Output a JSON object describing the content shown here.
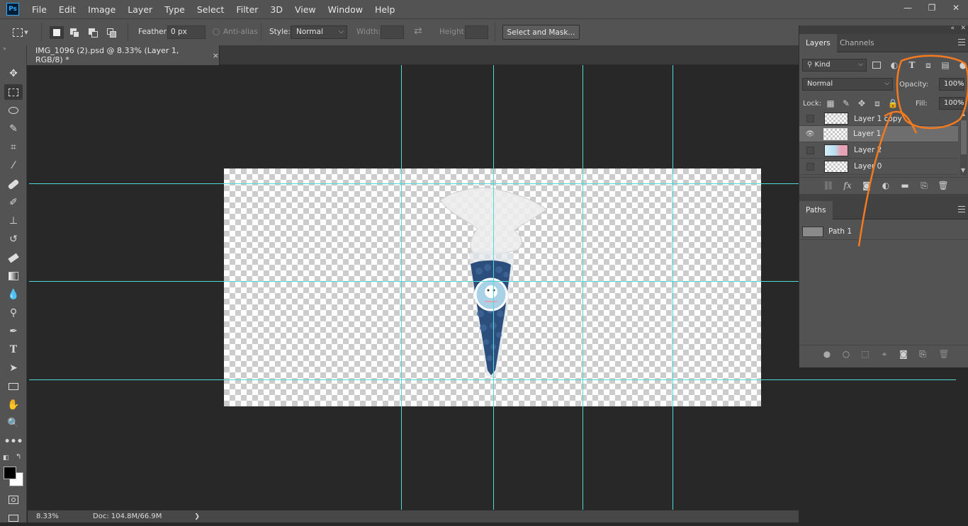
{
  "app": {
    "logo_text": "Ps",
    "menu": [
      "File",
      "Edit",
      "Image",
      "Layer",
      "Type",
      "Select",
      "Filter",
      "3D",
      "View",
      "Window",
      "Help"
    ]
  },
  "window_controls": {
    "minimize": "—",
    "restore": "❐",
    "close": "✕"
  },
  "options": {
    "feather_label": "Feather:",
    "feather_value": "0 px",
    "antialias_label": "Anti-alias",
    "style_label": "Style:",
    "style_value": "Normal",
    "width_label": "Width:",
    "height_label": "Height:",
    "select_mask_label": "Select and Mask..."
  },
  "document": {
    "tab_title": "IMG_1096 (2).psd @ 8.33% (Layer 1, RGB/8) *",
    "tab_close": "×"
  },
  "status": {
    "zoom": "8.33%",
    "doc_info": "Doc: 104.8M/66.9M",
    "arrow": "❯"
  },
  "layers_panel": {
    "tabs": [
      "Layers",
      "Channels"
    ],
    "filter_kind": "Kind",
    "blend_mode": "Normal",
    "opacity_label": "Opacity:",
    "opacity_value": "100%",
    "lock_label": "Lock:",
    "fill_label": "Fill:",
    "fill_value": "100%",
    "layers": [
      {
        "name": "Layer 1 copy",
        "visible": false,
        "selected": false
      },
      {
        "name": "Layer 1",
        "visible": true,
        "selected": true
      },
      {
        "name": "Layer 2",
        "visible": false,
        "selected": false
      },
      {
        "name": "Layer 0",
        "visible": false,
        "selected": false
      }
    ],
    "fx_label": "fx"
  },
  "paths_panel": {
    "tab": "Paths",
    "paths": [
      {
        "name": "Path 1"
      }
    ]
  },
  "colors": {
    "guide": "#4fd9d9",
    "annotation": "#f47a20",
    "panel": "#535353",
    "canvas_bg": "#282828",
    "foreground": "#000000",
    "background": "#ffffff"
  }
}
